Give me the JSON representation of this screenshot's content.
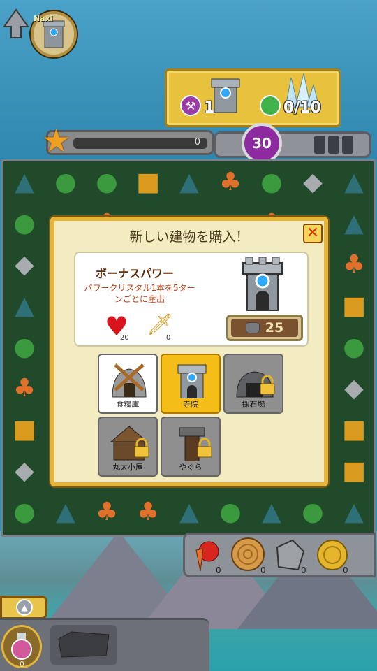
{
  "player": {
    "name": "Naxi"
  },
  "goals": {
    "hammer_count": "1",
    "crystal_progress": "0/10"
  },
  "progress": {
    "value": 0,
    "label": "0"
  },
  "moves": {
    "remaining": "30"
  },
  "modal": {
    "title": "新しい建物を購入！",
    "close_label": "✕",
    "power_title": "ボーナスパワー",
    "power_desc": "パワークリスタル1本を5ターンごとに産出",
    "heart_value": "20",
    "sword_value": "0",
    "cost": "25",
    "buildings": [
      {
        "label": "食糧庫",
        "state": "open"
      },
      {
        "label": "寺院",
        "state": "selected"
      },
      {
        "label": "採石場",
        "state": "locked"
      },
      {
        "label": "丸太小屋",
        "state": "locked"
      },
      {
        "label": "やぐら",
        "state": "locked"
      }
    ]
  },
  "resources": {
    "food": "0",
    "wood": "0",
    "stone": "0",
    "gold": "0"
  },
  "inventory": {
    "potion_count": "0"
  },
  "colors": {
    "accent": "#e6b43a",
    "selected": "#f5bd17",
    "moves": "#8e2aa0"
  }
}
